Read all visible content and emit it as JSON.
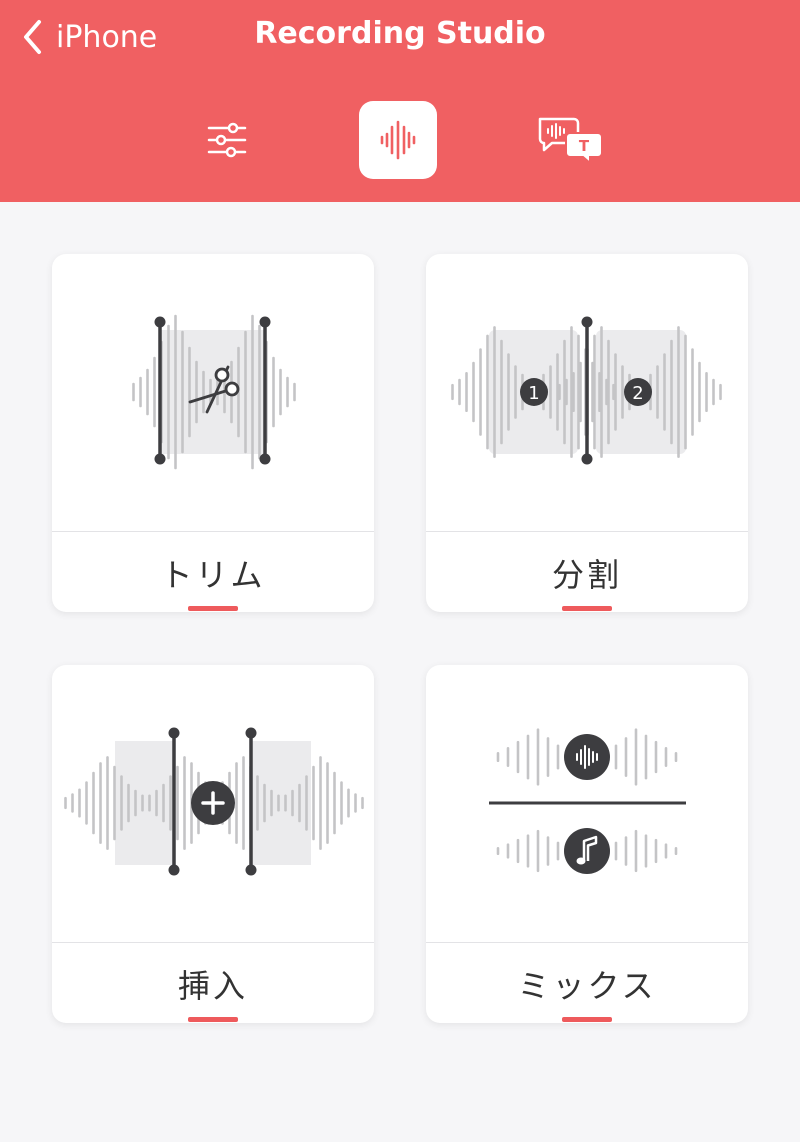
{
  "colors": {
    "accent": "#f06062",
    "underline": "#ee5a5c",
    "background": "#f6f6f8",
    "icon_dark": "#3d3d40",
    "wave_gray": "#c4c4c6",
    "panel_gray": "#ebebed"
  },
  "nav": {
    "back_label": "iPhone",
    "title": "Recording Studio"
  },
  "mode_tabs": [
    {
      "icon": "sliders-icon",
      "active": false
    },
    {
      "icon": "waveform-icon",
      "active": true
    },
    {
      "icon": "transcription-bubbles-icon",
      "active": false
    }
  ],
  "tools": [
    {
      "label": "トリム",
      "icon": "trim-icon"
    },
    {
      "label": "分割",
      "icon": "split-icon"
    },
    {
      "label": "挿入",
      "icon": "insert-icon"
    },
    {
      "label": "ミックス",
      "icon": "mix-icon"
    }
  ],
  "split_markers": [
    "1",
    "2"
  ],
  "tab_bubble_letter": "T"
}
